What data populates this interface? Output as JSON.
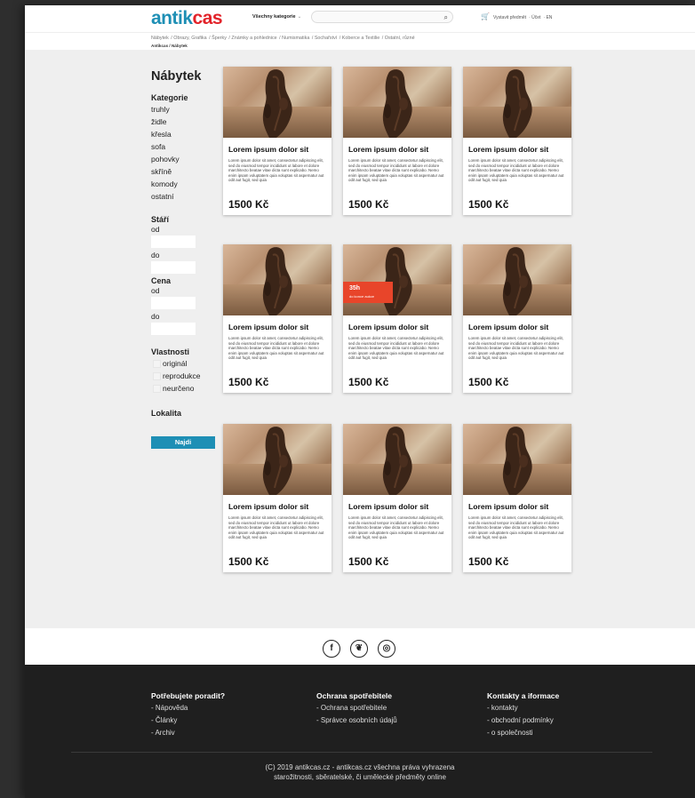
{
  "header": {
    "logo_part1": "antik",
    "logo_part2": "cas",
    "category_select": "Všechny kategorie",
    "search_placeholder": "",
    "links": [
      "Vystavit předmět",
      "Účet",
      "EN"
    ]
  },
  "menu": [
    "Nábytek",
    "Obrazy, Grafika",
    "Šperky",
    "Známky a pohlednice",
    "Numismatika",
    "Sochařství",
    "Koberce a Textilie",
    "Ostatní, různé"
  ],
  "breadcrumb": "Antikcas / Nábytek",
  "sidebar": {
    "title": "Nábytek",
    "categories_heading": "Kategorie",
    "categories": [
      "truhly",
      "židle",
      "křesla",
      "sofa",
      "pohovky",
      "skříně",
      "komody",
      "ostatní"
    ],
    "age_heading": "Stáří",
    "price_heading": "Cena",
    "from_label": "od",
    "to_label": "do",
    "properties_heading": "Vlastnosti",
    "properties": [
      "originál",
      "reprodukce",
      "neurčeno"
    ],
    "location_heading": "Lokalita",
    "find_button": "Najdi"
  },
  "products": [
    {
      "title": "Lorem ipsum dolor sit",
      "desc": "Lorem ipsum dolor sit amet, consectetur adipiscing elit, sed do eiusmod tempor incididunt ut labore et dolore marchitecto beatae vitae dicta sunt explicabo. Nemo enim ipsam voluptatem quia voluptas sit aspernatur aut odit aut fugit, sed quia",
      "price": "1500 Kč"
    },
    {
      "title": "Lorem ipsum dolor sit",
      "desc": "Lorem ipsum dolor sit amet, consectetur adipiscing elit, sed do eiusmod tempor incididunt ut labore et dolore marchitecto beatae vitae dicta sunt explicabo. Nemo enim ipsam voluptatem quia voluptas sit aspernatur aut odit aut fugit, sed quia",
      "price": "1500 Kč"
    },
    {
      "title": "Lorem ipsum dolor sit",
      "desc": "Lorem ipsum dolor sit amet, consectetur adipiscing elit, sed do eiusmod tempor incididunt ut labore et dolore marchitecto beatae vitae dicta sunt explicabo. Nemo enim ipsam voluptatem quia voluptas sit aspernatur aut odit aut fugit, sed quia",
      "price": "1500 Kč"
    },
    {
      "title": "Lorem ipsum dolor sit",
      "desc": "Lorem ipsum dolor sit amet, consectetur adipiscing elit, sed do eiusmod tempor incididunt ut labore et dolore marchitecto beatae vitae dicta sunt explicabo. Nemo enim ipsam voluptatem quia voluptas sit aspernatur aut odit aut fugit, sed quia",
      "price": "1500 Kč"
    },
    {
      "title": "Lorem ipsum dolor sit",
      "desc": "Lorem ipsum dolor sit amet, consectetur adipiscing elit, sed do eiusmod tempor incididunt ut labore et dolore marchitecto beatae vitae dicta sunt explicabo. Nemo enim ipsam voluptatem quia voluptas sit aspernatur aut odit aut fugit, sed quia",
      "price": "1500 Kč",
      "badge_time": "35h",
      "badge_text": "do konce aukce"
    },
    {
      "title": "Lorem ipsum dolor sit",
      "desc": "Lorem ipsum dolor sit amet, consectetur adipiscing elit, sed do eiusmod tempor incididunt ut labore et dolore marchitecto beatae vitae dicta sunt explicabo. Nemo enim ipsam voluptatem quia voluptas sit aspernatur aut odit aut fugit, sed quia",
      "price": "1500 Kč"
    },
    {
      "title": "Lorem ipsum dolor sit",
      "desc": "Lorem ipsum dolor sit amet, consectetur adipiscing elit, sed do eiusmod tempor incididunt ut labore et dolore marchitecto beatae vitae dicta sunt explicabo. Nemo enim ipsam voluptatem quia voluptas sit aspernatur aut odit aut fugit, sed quia",
      "price": "1500 Kč"
    },
    {
      "title": "Lorem ipsum dolor sit",
      "desc": "Lorem ipsum dolor sit amet, consectetur adipiscing elit, sed do eiusmod tempor incididunt ut labore et dolore marchitecto beatae vitae dicta sunt explicabo. Nemo enim ipsam voluptatem quia voluptas sit aspernatur aut odit aut fugit, sed quia",
      "price": "1500 Kč"
    },
    {
      "title": "Lorem ipsum dolor sit",
      "desc": "Lorem ipsum dolor sit amet, consectetur adipiscing elit, sed do eiusmod tempor incididunt ut labore et dolore marchitecto beatae vitae dicta sunt explicabo. Nemo enim ipsam voluptatem quia voluptas sit aspernatur aut odit aut fugit, sed quia",
      "price": "1500 Kč"
    }
  ],
  "social": {
    "icons": [
      "facebook-icon",
      "twitter-icon",
      "instagram-icon"
    ],
    "glyphs": [
      "f",
      "❦",
      "◎"
    ]
  },
  "footer": {
    "col1": {
      "heading": "Potřebujete poradit?",
      "items": [
        "- Nápověda",
        "- Články",
        "- Archiv"
      ]
    },
    "col2": {
      "heading": "Ochrana spotřebitele",
      "items": [
        "- Ochrana spotřebitele",
        "- Správce osobních údajů"
      ]
    },
    "col3": {
      "heading": "Kontakty a iformace",
      "items": [
        "- kontakty",
        "- obchodní podmínky",
        "- o společnosti"
      ]
    },
    "copyright_line1": "(C) 2019 antikcas.cz - antikcas.cz všechna práva vyhrazena",
    "copyright_line2": "starožitnosti, sběratelské, či umělecké předměty online"
  },
  "colors": {
    "brand_blue": "#1e8fb5",
    "brand_red": "#e2232a",
    "badge": "#e8452a",
    "footer_bg": "#1f1f1f"
  }
}
